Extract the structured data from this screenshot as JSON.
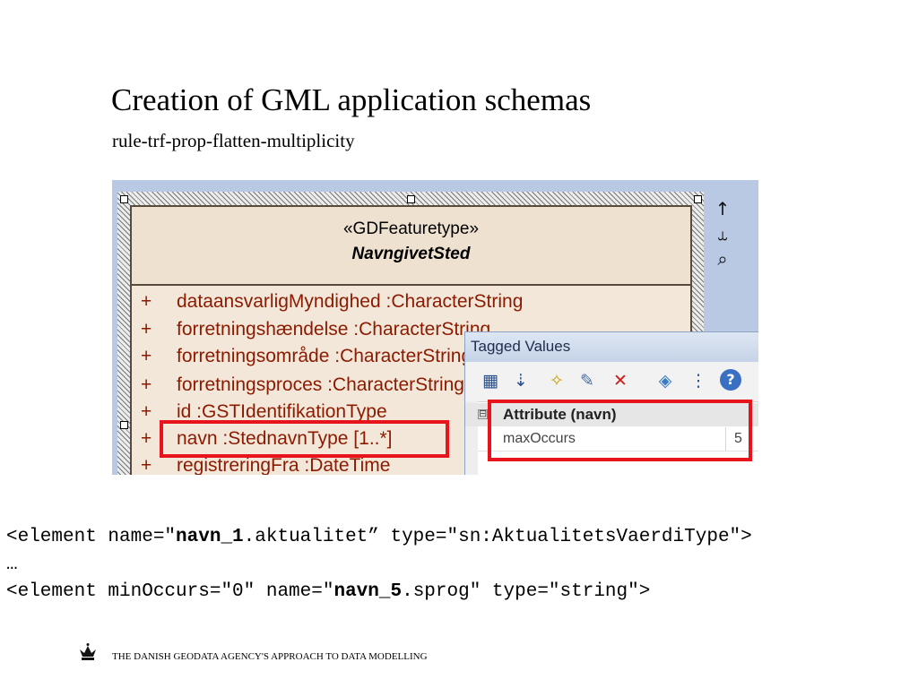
{
  "slide": {
    "title": "Creation of GML application schemas",
    "subtitle": "rule-trf-prop-flatten-multiplicity"
  },
  "uml_class": {
    "stereotype": "«GDFeaturetype»",
    "name": "NavngivetSted",
    "attributes": [
      {
        "visibility": "+",
        "text": "dataansvarligMyndighed  :CharacterString"
      },
      {
        "visibility": "+",
        "text": "forretningshændelse  :CharacterString"
      },
      {
        "visibility": "+",
        "text": "forretningsområde  :CharacterString"
      },
      {
        "visibility": "+",
        "text": "forretningsproces  :CharacterString"
      },
      {
        "visibility": "+",
        "text": "id  :GSTIdentifikationType"
      },
      {
        "visibility": "+",
        "text": "navn  :StednavnType [1..*]"
      },
      {
        "visibility": "+",
        "text": "registreringFra  :DateTime"
      }
    ]
  },
  "side_icons": {
    "up": "↑",
    "link": "⥿",
    "zoom": "⌕"
  },
  "tagged_values": {
    "title": "Tagged Values",
    "toolbar": [
      {
        "name": "categorized-icon",
        "glyph": "▦"
      },
      {
        "name": "sort-az-icon",
        "glyph": "⇣"
      },
      {
        "name": "new-tag-icon",
        "glyph": "✧"
      },
      {
        "name": "edit-tag-icon",
        "glyph": "✎"
      },
      {
        "name": "delete-tag-icon",
        "glyph": "✕"
      },
      {
        "name": "tag-icon",
        "glyph": "◈"
      },
      {
        "name": "options-icon",
        "glyph": "⋮"
      },
      {
        "name": "help-icon",
        "glyph": "?"
      }
    ],
    "category": "Attribute (navn)",
    "expander": "⊟",
    "rows": [
      {
        "key": "maxOccurs",
        "value": "5"
      }
    ]
  },
  "code": {
    "line1": {
      "pre": "<element name=\"",
      "bold": "navn_1",
      "post": ".aktualitet” type=\"sn:AktualitetsVaerdiType\">"
    },
    "line2": "…",
    "line3": {
      "pre": "<element minOccurs=\"0\" name=\"",
      "bold": "navn_5",
      "post": ".sprog\" type=\"string\">"
    }
  },
  "footer": {
    "text": "THE DANISH GEODATA AGENCY'S APPROACH TO DATA MODELLING"
  },
  "colors": {
    "highlight": "#e8141c",
    "attribute_text": "#8b1a00",
    "panel_background": "#b9c8e3"
  }
}
